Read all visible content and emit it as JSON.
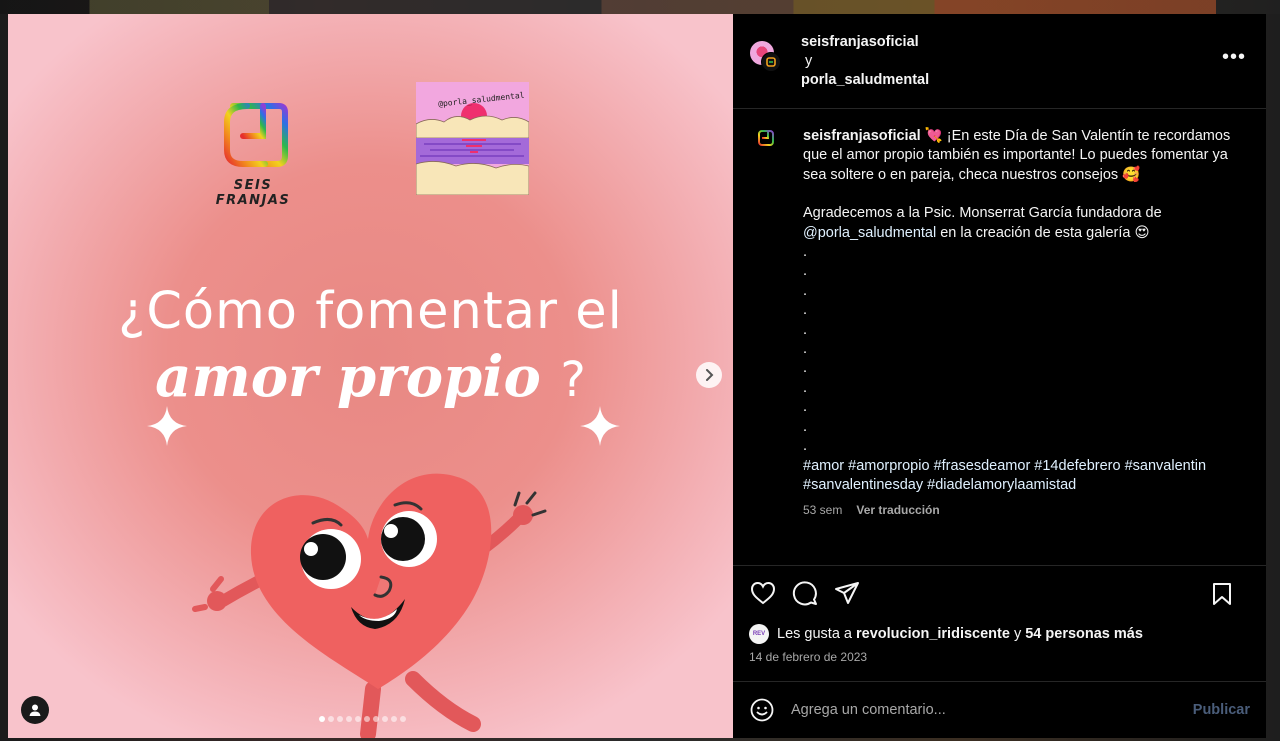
{
  "media": {
    "logo_left_caption": "SEIS FRANJAS",
    "logo_right_text": "@porla_saludmental",
    "headline_line1": "¿Cómo fomentar el",
    "headline_line2": "amor propio",
    "headline_q": "?",
    "carousel": {
      "total": 10,
      "active": 0
    },
    "icons": {
      "next": "chevron-right-icon",
      "tagged_users": "user-icon"
    }
  },
  "header": {
    "user1": "seisfranjasoficial",
    "joiner": "y",
    "user2": "porla_saludmental",
    "more": "•••"
  },
  "caption": {
    "user": "seisfranjasoficial",
    "para1": "💘 ¡En este Día de San Valentín te recordamos que el amor propio también es importante! Lo puedes fomentar ya sea soltere o en pareja, checa nuestros consejos 🥰",
    "para2_prefix": "Agradecemos a la Psic. Monserrat García fundadora de",
    "para2_mention": "@porla_saludmental",
    "para2_suffix": " en la creación de esta galería 😍",
    "dots": [
      ".",
      ".",
      ".",
      ".",
      ".",
      ".",
      ".",
      ".",
      ".",
      ".",
      "."
    ],
    "hashtags": "#amor #amorpropio #frasesdeamor #14defebrero #sanvalentin #sanvalentinesday #diadelamorylaamistad",
    "age": "53 sem",
    "translate": "Ver traducción"
  },
  "actions": {
    "likes_prefix": "Les gusta a ",
    "likes_user": "revolucion_iridiscente",
    "likes_mid": " y ",
    "likes_count": "54 personas más",
    "likes_avatar_text": "REV",
    "date": "14 de febrero de 2023"
  },
  "comment": {
    "placeholder": "Agrega un comentario...",
    "publish": "Publicar"
  },
  "colors": {
    "accent_pink": "#ec8f8b",
    "heart_red": "#ef5f5e",
    "text_muted": "#a8a8a8",
    "link": "#e0f1ff",
    "publish_disabled": "#4a5d7a"
  }
}
